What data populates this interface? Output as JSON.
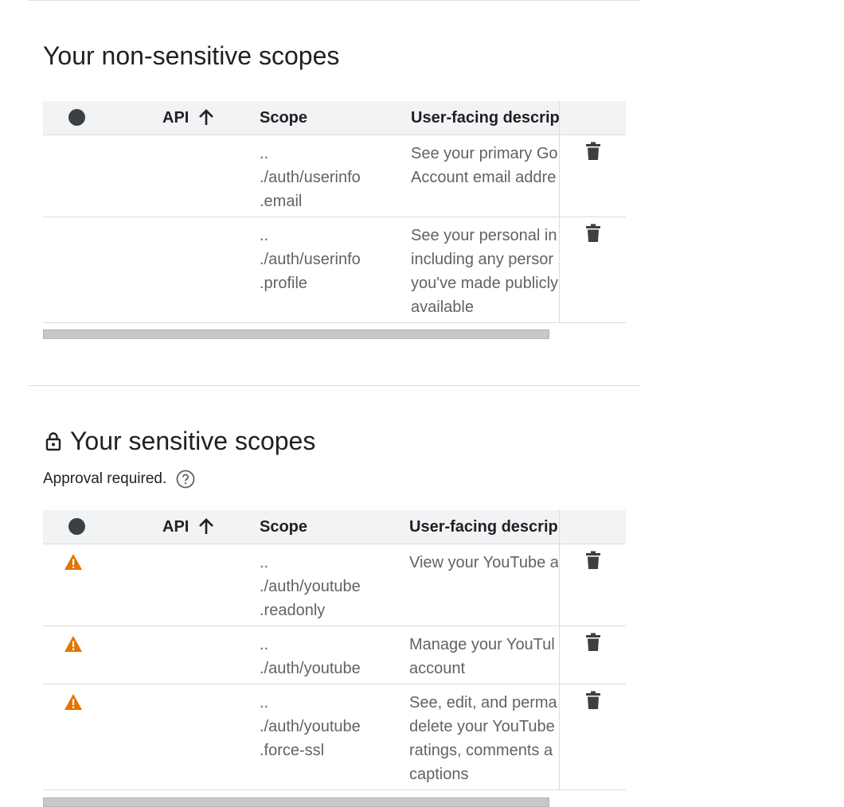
{
  "non_sensitive": {
    "title": "Your non-sensitive scopes",
    "columns": {
      "api": "API",
      "scope": "Scope",
      "description": "User-facing descrip"
    },
    "rows": [
      {
        "scope_lines": [
          "..",
          "./auth/userinfo",
          ".email"
        ],
        "desc_lines": [
          "See your primary Go",
          "Account email addre"
        ]
      },
      {
        "scope_lines": [
          "..",
          "./auth/userinfo",
          ".profile"
        ],
        "desc_lines": [
          "See your personal in",
          "including any persor",
          "you've made publicly",
          "available"
        ]
      }
    ]
  },
  "sensitive": {
    "title": "Your sensitive scopes",
    "approval_text": "Approval required.",
    "columns": {
      "api": "API",
      "scope": "Scope",
      "description": "User-facing descrip"
    },
    "rows": [
      {
        "scope_lines": [
          "..",
          "./auth/youtube",
          ".readonly"
        ],
        "desc_lines": [
          "View your YouTube a"
        ]
      },
      {
        "scope_lines": [
          "..",
          "./auth/youtube"
        ],
        "desc_lines": [
          "Manage your YouTul",
          "account"
        ]
      },
      {
        "scope_lines": [
          "..",
          "./auth/youtube",
          ".force-ssl"
        ],
        "desc_lines": [
          "See, edit, and perma",
          "delete your YouTube",
          "ratings, comments a",
          "captions"
        ]
      }
    ]
  },
  "icons": {
    "sort": "arrow-upward-icon",
    "delete": "trash-icon",
    "warning": "warning-icon",
    "lock": "lock-icon",
    "help": "help-icon"
  },
  "colors": {
    "warning": "#e37400",
    "header_bg": "#f1f3f4",
    "icon": "#3c4043"
  }
}
